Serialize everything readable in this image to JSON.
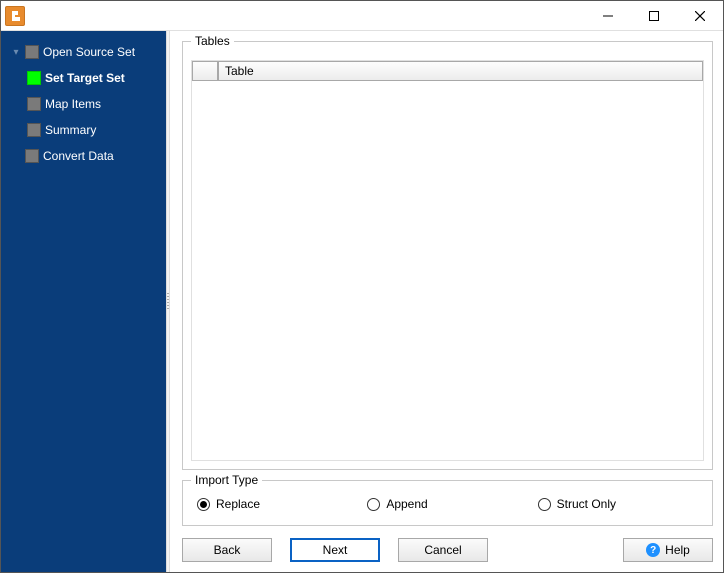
{
  "titlebar": {
    "icon_letter": "",
    "title": ""
  },
  "sidebar": {
    "items": [
      {
        "label": "Open Source Set",
        "current": false,
        "level": 0
      },
      {
        "label": "Set Target Set",
        "current": true,
        "level": 1
      },
      {
        "label": "Map Items",
        "current": false,
        "level": 1
      },
      {
        "label": "Summary",
        "current": false,
        "level": 1
      },
      {
        "label": "Convert Data",
        "current": false,
        "level": 0
      }
    ]
  },
  "tables": {
    "legend": "Tables",
    "columns": {
      "checkbox": "",
      "main": "Table"
    }
  },
  "import": {
    "legend": "Import Type",
    "options": [
      {
        "label": "Replace",
        "selected": true
      },
      {
        "label": "Append",
        "selected": false
      },
      {
        "label": "Struct Only",
        "selected": false
      }
    ]
  },
  "buttons": {
    "back": "Back",
    "next": "Next",
    "cancel": "Cancel",
    "help": "Help"
  }
}
